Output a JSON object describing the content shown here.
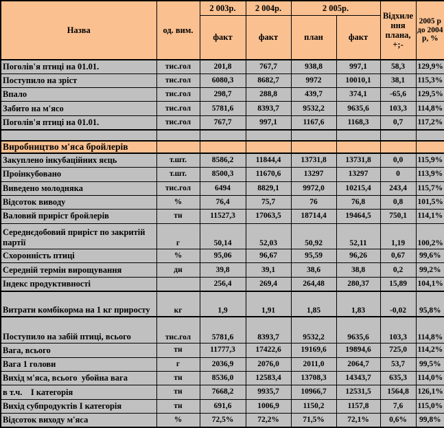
{
  "colors": {
    "header_bg": "#FAC090",
    "row_bg": "#C0C0C0",
    "border": "#000000",
    "text": "#000000"
  },
  "table": {
    "header": {
      "name": "Назва",
      "unit": "од. вим.",
      "y2003": "2 003р.",
      "y2004": "2 004р.",
      "y2005": "2 005р.",
      "sub_2003": "факт",
      "sub_2004": "факт",
      "sub_2005_plan": "план",
      "sub_2005_fact": "факт",
      "deviation": "Відхилення плана, +;-",
      "ratio": "2005 р до 2004 р, %"
    },
    "rows": [
      {
        "label": "Поголів'я птиці на 01.01.",
        "unit": "тис.гол",
        "values": [
          "201,8",
          "767,7",
          "938,8",
          "997,1",
          "58,3",
          "129,9%"
        ]
      },
      {
        "label": "Поступило на зріст",
        "unit": "тис.гол",
        "values": [
          "6080,3",
          "8682,7",
          "9972",
          "10010,1",
          "38,1",
          "115,3%"
        ]
      },
      {
        "label": "Впало",
        "unit": "тис.гол",
        "values": [
          "298,7",
          "288,8",
          "439,7",
          "374,1",
          "-65,6",
          "129,5%"
        ]
      },
      {
        "label": "Забито на м'ясо",
        "unit": "тис.гол",
        "values": [
          "5781,6",
          "8393,7",
          "9532,2",
          "9635,6",
          "103,3",
          "114,8%"
        ]
      },
      {
        "label": "Поголів'я птиці на 01.01.",
        "unit": "тис.гол",
        "values": [
          "767,7",
          "997,1",
          "1167,6",
          "1168,3",
          "0,7",
          "117,2%"
        ],
        "thick_bottom": true
      },
      {
        "type": "empty"
      },
      {
        "type": "section",
        "label": "Виробництво м'яса бройлерів"
      },
      {
        "label": "Закуплено інкубаційних яєць",
        "unit": "т.шт.",
        "values": [
          "8586,2",
          "11844,4",
          "13731,8",
          "13731,8",
          "0,0",
          "115,9%"
        ]
      },
      {
        "label": "Проінкубовано",
        "unit": "т.шт.",
        "values": [
          "8500,3",
          "11670,6",
          "13297",
          "13297",
          "0",
          "113,9%"
        ]
      },
      {
        "label": "Виведено молодняка",
        "unit": "тис.гол",
        "values": [
          "6494",
          "8829,1",
          "9972,0",
          "10215,4",
          "243,4",
          "115,7%"
        ]
      },
      {
        "label": "Відсоток виводу",
        "unit": "%",
        "values": [
          "76,4",
          "75,7",
          "76",
          "76,8",
          "0,8",
          "101,5%"
        ]
      },
      {
        "label": "Валовий приріст бройлерів",
        "unit": "тн",
        "values": [
          "11527,3",
          "17063,5",
          "18714,4",
          "19464,5",
          "750,1",
          "114,1%"
        ]
      },
      {
        "label": "Середнєдобовий приріст по закритій партії",
        "unit": "г",
        "values": [
          "50,14",
          "52,03",
          "50,92",
          "52,11",
          "1,19",
          "100,2%"
        ],
        "tall": true
      },
      {
        "label": "Схоронність птиці",
        "unit": "%",
        "values": [
          "95,06",
          "96,67",
          "95,59",
          "96,26",
          "0,67",
          "99,6%"
        ]
      },
      {
        "label": "Середній термін вирощування",
        "unit": "дн",
        "values": [
          "39,8",
          "39,1",
          "38,6",
          "38,8",
          "0,2",
          "99,2%"
        ]
      },
      {
        "label": "Індекс продуктивності",
        "unit": "",
        "values": [
          "256,4",
          "269,4",
          "264,48",
          "280,37",
          "15,89",
          "104,1%"
        ],
        "thick_bottom": true
      },
      {
        "label": "Витрати комбікорма на 1 кг приросту",
        "unit": "кг",
        "values": [
          "1,9",
          "1,91",
          "1,85",
          "1,83",
          "-0,02",
          "95,8%"
        ],
        "tall": true,
        "thick_bottom": true
      },
      {
        "label": "Поступило на забій птиці, всього",
        "unit": "тис.гол",
        "values": [
          "5781,6",
          "8393,7",
          "9532,2",
          "9635,6",
          "103,3",
          "114,8%"
        ],
        "tall_gap": true
      },
      {
        "label": "Вага, всього",
        "unit": "тн",
        "values": [
          "11777,3",
          "17422,6",
          "19169,6",
          "19894,6",
          "725,0",
          "114,2%"
        ]
      },
      {
        "label": "Вага 1 голови",
        "unit": "г",
        "values": [
          "2036,9",
          "2076,0",
          "2011,0",
          "2064,7",
          "53,7",
          "99,5%"
        ]
      },
      {
        "label": "Вихід м'яса, всього  убойна вага",
        "unit": "тн",
        "values": [
          "8536,0",
          "12583,4",
          "13708,3",
          "14343,7",
          "635,3",
          "114,0%"
        ]
      },
      {
        "label": "в т.ч.    І категорія",
        "unit": "тн",
        "values": [
          "7668,2",
          "9935,7",
          "10966,7",
          "12531,5",
          "1564,8",
          "126,1%"
        ]
      },
      {
        "label": "Вихід субпродуктів І категорія",
        "unit": "тн",
        "values": [
          "691,6",
          "1006,9",
          "1150,2",
          "1157,8",
          "7,6",
          "115,0%"
        ]
      },
      {
        "label": "Відсоток виходу м'яса",
        "unit": "%",
        "values": [
          "72,5%",
          "72,2%",
          "71,5%",
          "72,1%",
          "0,6%",
          "99,8%"
        ]
      }
    ]
  }
}
